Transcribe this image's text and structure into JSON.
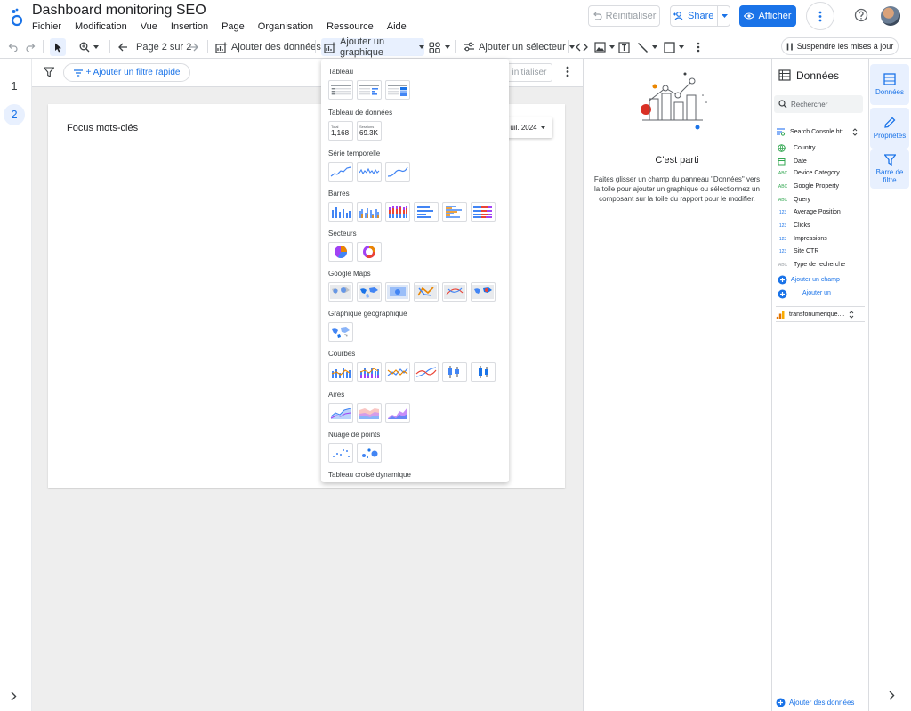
{
  "app": {
    "title": "Dashboard monitoring SEO"
  },
  "menu": [
    "Fichier",
    "Modification",
    "Vue",
    "Insertion",
    "Page",
    "Organisation",
    "Ressource",
    "Aide"
  ],
  "header": {
    "reset_label": "Réinitialiser",
    "share_label": "Share",
    "view_label": "Afficher"
  },
  "toolbar": {
    "page_label": "Page 2 sur 2",
    "add_data_label": "Ajouter des données",
    "add_chart_label": "Ajouter un graphique",
    "add_control_label": "Ajouter un sélecteur",
    "pause_label": "Suspendre les mises à jour"
  },
  "pages": [
    "1",
    "2"
  ],
  "filterbar": {
    "add_filter_label": "+ Ajouter un filtre rapide",
    "reset_ghost": "initialiser"
  },
  "canvas": {
    "title": "Focus mots-clés",
    "date_label": "uil. 2024"
  },
  "chart_menu": {
    "sections": [
      "Tableau",
      "Tableau de données",
      "Série temporelle",
      "Barres",
      "Secteurs",
      "Google Maps",
      "Graphique géographique",
      "Courbes",
      "Aires",
      "Nuage de points",
      "Tableau croisé dynamique"
    ],
    "scorecards": [
      {
        "label": "Total",
        "value": "1,168"
      },
      {
        "label": "Sessions",
        "value": "69.3K"
      }
    ]
  },
  "start": {
    "title": "C'est parti",
    "description": "Faites glisser un champ du panneau \"Données\" vers la toile pour ajouter un graphique ou sélectionnez un composant sur la toile du rapport pour le modifier."
  },
  "data_panel": {
    "title": "Données",
    "search_placeholder": "Rechercher",
    "source": "Search Console htt...",
    "fields": [
      {
        "name": "Country",
        "type": "geo"
      },
      {
        "name": "Date",
        "type": "date"
      },
      {
        "name": "Device Category",
        "type": "ABC"
      },
      {
        "name": "Google Property",
        "type": "ABC"
      },
      {
        "name": "Query",
        "type": "ABC"
      },
      {
        "name": "Average Position",
        "type": "123"
      },
      {
        "name": "Clicks",
        "type": "123"
      },
      {
        "name": "Impressions",
        "type": "123"
      },
      {
        "name": "Site CTR",
        "type": "123"
      },
      {
        "name": "Type de recherche",
        "type": "ABC"
      }
    ],
    "add_field": "Ajouter un champ",
    "add_param": "Ajouter un paramètre",
    "source2": "transfonumerique....",
    "add_data_bottom": "Ajouter des données"
  },
  "right_tabs": {
    "data": "Données",
    "props": "Propriétés",
    "filter": "Barre de filtre"
  },
  "colors": {
    "accent": "#1a73e8",
    "tab_bg": "#e8f0fe",
    "canvas_bg": "#eeeeee"
  }
}
